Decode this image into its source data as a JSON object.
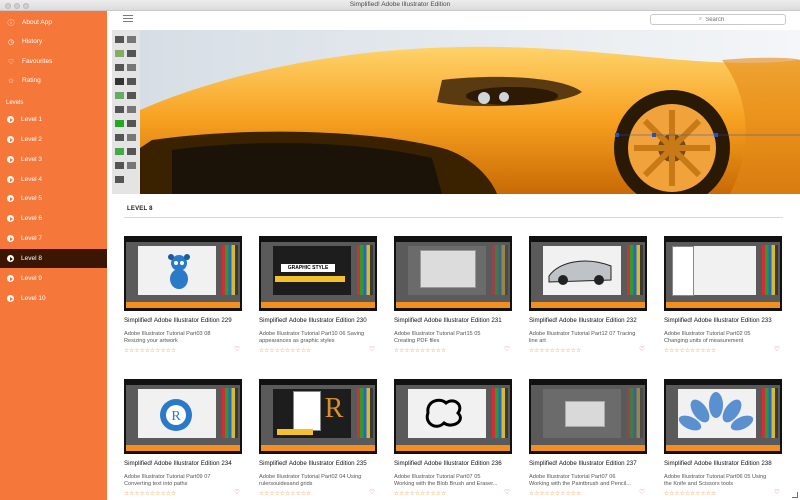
{
  "window": {
    "title": "Simplified! Adobe Illustrator Edition"
  },
  "sidebar": {
    "top_items": [
      {
        "label": "About App",
        "icon": "info-icon"
      },
      {
        "label": "History",
        "icon": "clock-icon"
      },
      {
        "label": "Favourites",
        "icon": "heart-icon"
      },
      {
        "label": "Rating",
        "icon": "star-icon"
      }
    ],
    "section_label": "Levels",
    "levels": [
      {
        "label": "Level 1"
      },
      {
        "label": "Level 2"
      },
      {
        "label": "Level 3"
      },
      {
        "label": "Level 4"
      },
      {
        "label": "Level 5"
      },
      {
        "label": "Level 6"
      },
      {
        "label": "Level 7"
      },
      {
        "label": "Level 8"
      },
      {
        "label": "Level 9"
      },
      {
        "label": "Level 10"
      }
    ],
    "active_level": "Level 8"
  },
  "toolbar": {
    "search_placeholder": "Search"
  },
  "main": {
    "level_heading": "LEVEL 8",
    "rating_stars": "☆☆☆☆☆☆☆☆☆☆",
    "cards": [
      {
        "title": "Simplified! Adobe Illustrator Edition 229",
        "desc": "Adobe Illustrator Tutorial    Part03 08 Resizing your artwork"
      },
      {
        "title": "Simplified! Adobe Illustrator Edition 230",
        "desc": "Adobe Illustrator Tutorial    Part10 06 Saving appearances as graphic styles"
      },
      {
        "title": "Simplified! Adobe Illustrator Edition 231",
        "desc": "Adobe Illustrator Tutorial    Part15 05 Creating PDF files"
      },
      {
        "title": "Simplified! Adobe Illustrator Edition 232",
        "desc": "Adobe Illustrator Tutorial    Part12 07 Tracing line art"
      },
      {
        "title": "Simplified! Adobe Illustrator Edition 233",
        "desc": "Adobe Illustrator Tutorial    Part02 05 Changing units of measurement"
      },
      {
        "title": "Simplified! Adobe Illustrator Edition 234",
        "desc": "Adobe Illustrator Tutorial    Part09 07 Converting text into paths"
      },
      {
        "title": "Simplified! Adobe Illustrator Edition 235",
        "desc": "Adobe Illustrator Tutorial    Part02 04 Using rulersouidesand grids"
      },
      {
        "title": "Simplified! Adobe Illustrator Edition 236",
        "desc": "Adobe Illustrator Tutorial    Part07 05 Working with the Blob Brush and Eraser..."
      },
      {
        "title": "Simplified! Adobe Illustrator Edition 237",
        "desc": "Adobe Illustrator Tutorial    Part07 06 Working with the Paintbrush and Pencil..."
      },
      {
        "title": "Simplified! Adobe Illustrator Edition 238",
        "desc": "Adobe Illustrator Tutorial    Part06 05 Using the Knife and Scissors tools"
      }
    ]
  },
  "colors": {
    "sidebar_bg": "#f6773a",
    "active_item_bg": "#3b1703",
    "heart": "#e24a6b",
    "stars": "#f08a24"
  }
}
